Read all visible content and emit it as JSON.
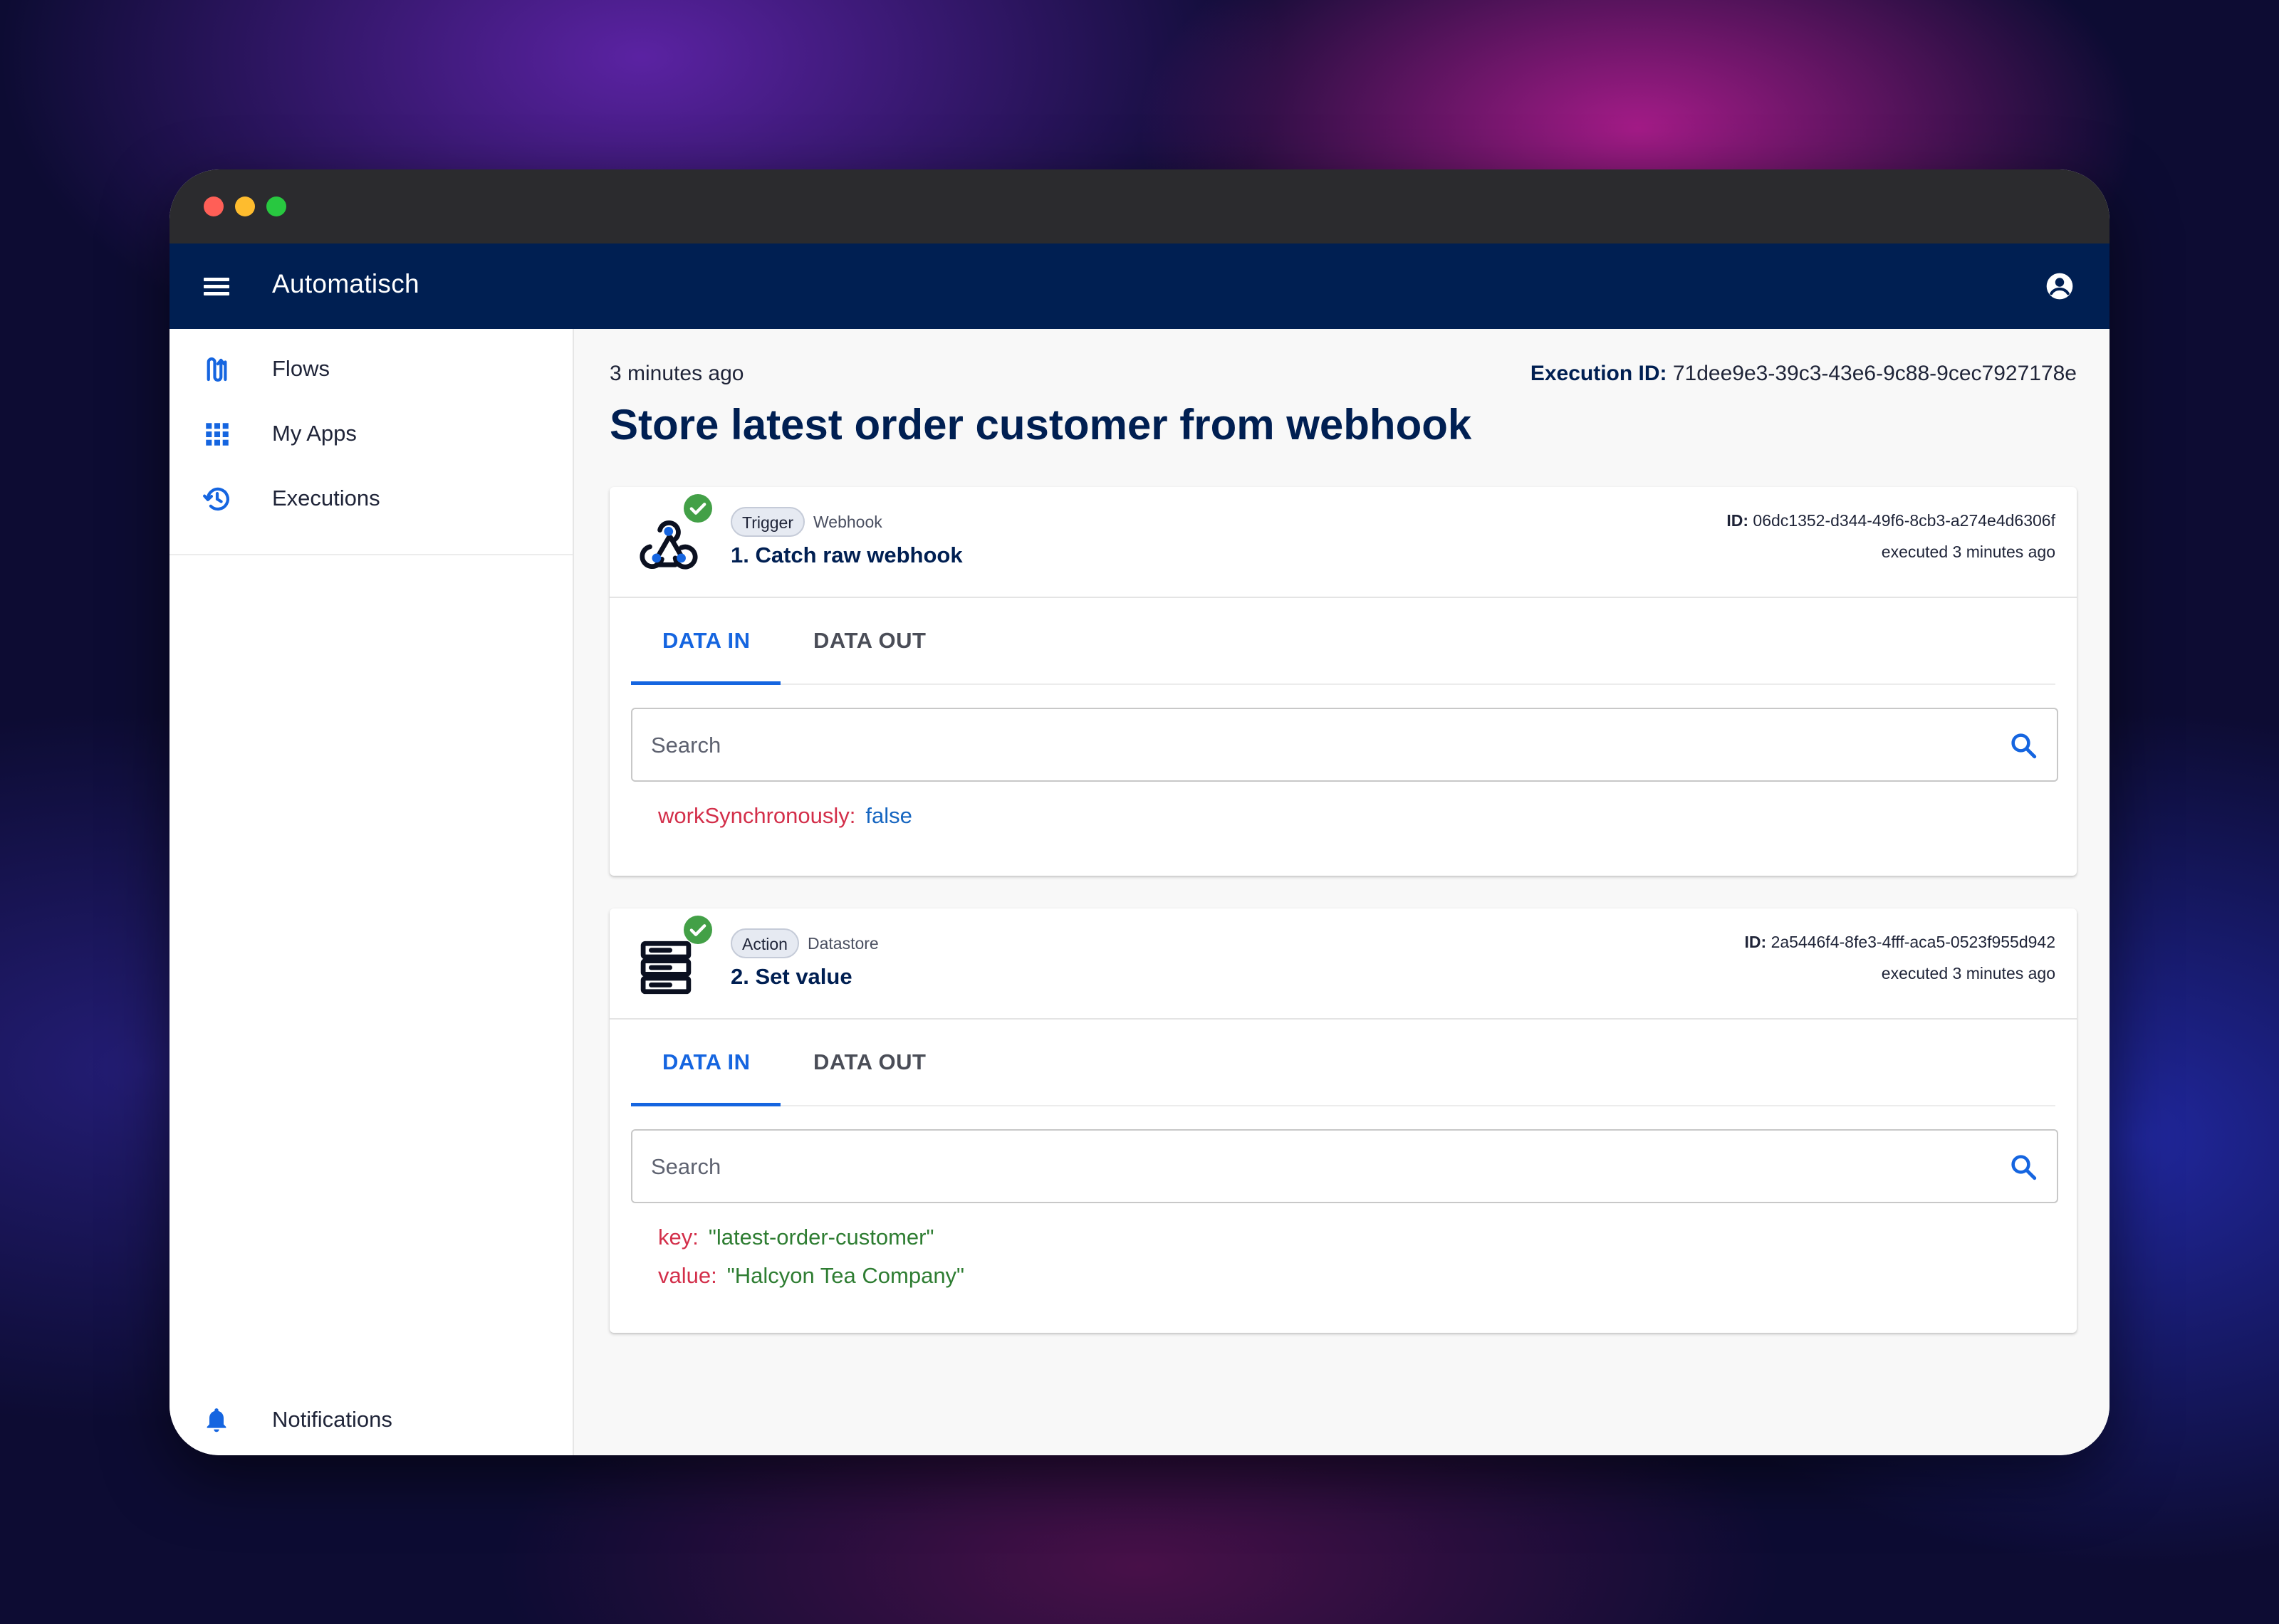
{
  "window": {
    "controls": [
      "close",
      "minimize",
      "maximize"
    ]
  },
  "appbar": {
    "title": "Automatisch",
    "menu_icon": "hamburger-menu-icon",
    "account_icon": "account-circle-icon"
  },
  "sidebar": {
    "items": [
      {
        "label": "Flows",
        "icon": "flows-icon"
      },
      {
        "label": "My Apps",
        "icon": "apps-grid-icon"
      },
      {
        "label": "Executions",
        "icon": "history-icon"
      }
    ],
    "notifications": {
      "label": "Notifications",
      "icon": "bell-icon"
    }
  },
  "execution": {
    "time_ago": "3 minutes ago",
    "id_label": "Execution ID:",
    "id_value": "71dee9e3-39c3-43e6-9c88-9cec7927178e",
    "flow_title": "Store latest order customer from webhook"
  },
  "steps": [
    {
      "badge": "Trigger",
      "app": "Webhook",
      "name": "1. Catch raw webhook",
      "id_label": "ID:",
      "id_value": "06dc1352-d344-49f6-8cb3-a274e4d6306f",
      "executed": "executed 3 minutes ago",
      "icon": "webhook-icon",
      "status": "success",
      "tabs": {
        "data_in": "DATA IN",
        "data_out": "DATA OUT",
        "active": "DATA IN"
      },
      "search": {
        "placeholder": "Search",
        "value": ""
      },
      "data": [
        {
          "key": "workSynchronously:",
          "value": "false",
          "type": "boolean"
        }
      ]
    },
    {
      "badge": "Action",
      "app": "Datastore",
      "name": "2. Set value",
      "id_label": "ID:",
      "id_value": "2a5446f4-8fe3-4fff-aca5-0523f955d942",
      "executed": "executed 3 minutes ago",
      "icon": "datastore-icon",
      "status": "success",
      "tabs": {
        "data_in": "DATA IN",
        "data_out": "DATA OUT",
        "active": "DATA IN"
      },
      "search": {
        "placeholder": "Search",
        "value": ""
      },
      "data": [
        {
          "key": "key:",
          "value": "\"latest-order-customer\"",
          "type": "string"
        },
        {
          "key": "value:",
          "value": "\"Halcyon Tea Company\"",
          "type": "string"
        }
      ]
    }
  ],
  "colors": {
    "appbar": "#001f52",
    "accent": "#1565e0",
    "success": "#43a047",
    "json_key": "#d32f4a",
    "json_string": "#2e7d32",
    "json_boolean": "#1565c0"
  }
}
